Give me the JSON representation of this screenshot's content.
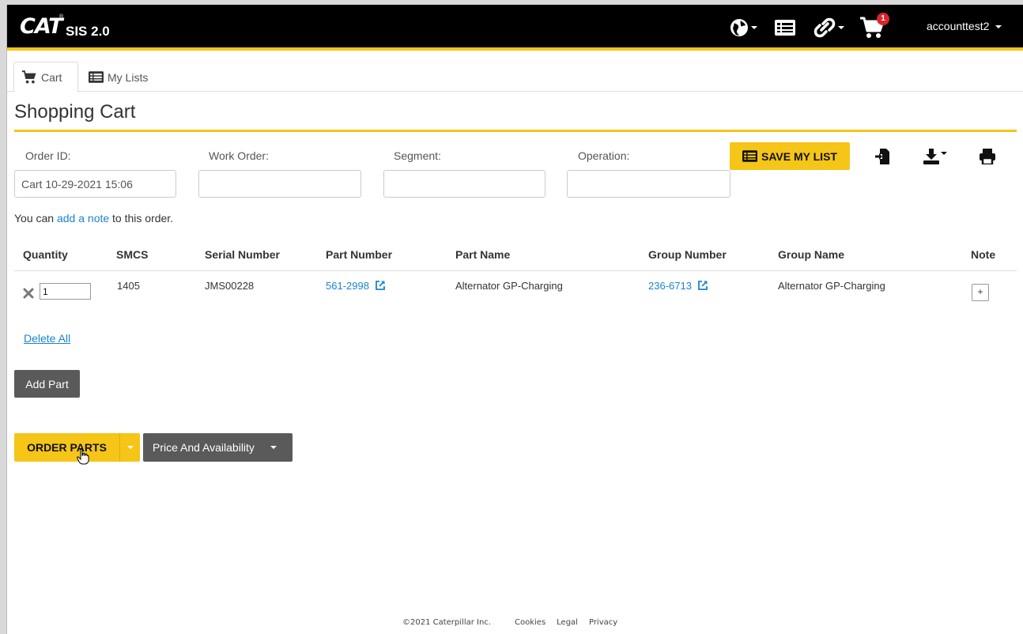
{
  "header": {
    "logo": "CAT",
    "logo_mark": "®",
    "product": "SIS 2.0",
    "cart_count": "1",
    "username": "accounttest2",
    "icons": [
      "globe-icon",
      "list-icon",
      "link-icon",
      "cart-icon"
    ]
  },
  "tabs": [
    {
      "label": "Cart",
      "icon": "cart-icon",
      "active": true
    },
    {
      "label": "My Lists",
      "icon": "list-icon",
      "active": false
    }
  ],
  "page": {
    "title": "Shopping Cart"
  },
  "form": {
    "order_id_label": "Order ID:",
    "order_id_value": "Cart 10-29-2021 15:06",
    "work_order_label": "Work Order:",
    "work_order_value": "",
    "segment_label": "Segment:",
    "segment_value": "",
    "operation_label": "Operation:",
    "operation_value": ""
  },
  "toolbar": {
    "save_list_label": "SAVE MY LIST",
    "icons": [
      "import-icon",
      "download-icon",
      "print-icon"
    ]
  },
  "note": {
    "prefix": "You can ",
    "link": "add a note",
    "suffix": " to this order."
  },
  "table": {
    "headers": {
      "quantity": "Quantity",
      "smcs": "SMCS",
      "serial": "Serial Number",
      "part_number": "Part Number",
      "part_name": "Part Name",
      "group_number": "Group Number",
      "group_name": "Group Name",
      "note": "Note"
    },
    "rows": [
      {
        "quantity": "1",
        "smcs": "1405",
        "serial": "JMS00228",
        "part_number": "561-2998",
        "part_name": "Alternator GP-Charging",
        "group_number": "236-6713",
        "group_name": "Alternator GP-Charging",
        "note_button": "+"
      }
    ]
  },
  "actions": {
    "delete_all": "Delete All",
    "add_part": "Add Part",
    "order_parts": "ORDER PARTS",
    "price_availability": "Price And Availability"
  },
  "footer": {
    "copyright": "©2021 Caterpillar Inc.",
    "links": [
      "Cookies",
      "Legal",
      "Privacy"
    ]
  },
  "colors": {
    "brand_yellow": "#f5c518",
    "header_black": "#000000",
    "link_blue": "#1a84ce",
    "dark_button": "#5a5a5a",
    "badge_red": "#d9262b"
  }
}
